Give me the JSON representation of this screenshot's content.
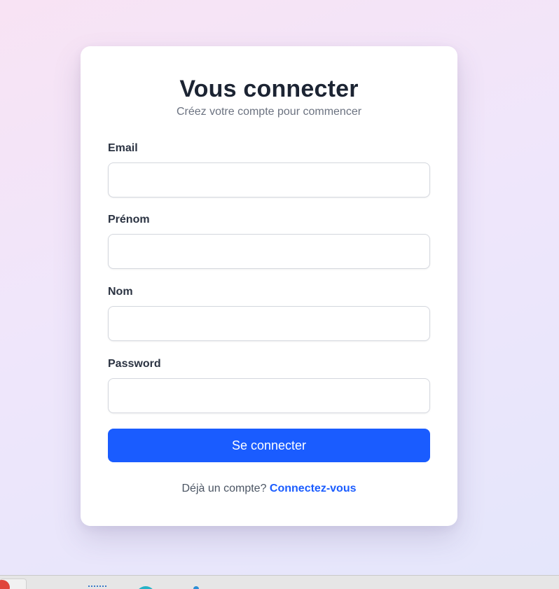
{
  "form": {
    "title": "Vous connecter",
    "subtitle": "Créez votre compte pour commencer",
    "fields": [
      {
        "label": "Email",
        "value": "",
        "placeholder": ""
      },
      {
        "label": "Prénom",
        "value": "",
        "placeholder": ""
      },
      {
        "label": "Nom",
        "value": "",
        "placeholder": ""
      },
      {
        "label": "Password",
        "value": "",
        "placeholder": ""
      }
    ],
    "submit_label": "Se connecter",
    "footer_text": "Déjà un compte?",
    "footer_link": "Connectez-vous"
  },
  "colors": {
    "accent": "#1a5cff",
    "title": "#1c2433",
    "muted": "#6b7280"
  },
  "taskbar": {
    "icons": [
      "app-icon-red",
      "window-slot",
      "dots-icon",
      "teal-app-icon",
      "blue-app-icon"
    ]
  }
}
